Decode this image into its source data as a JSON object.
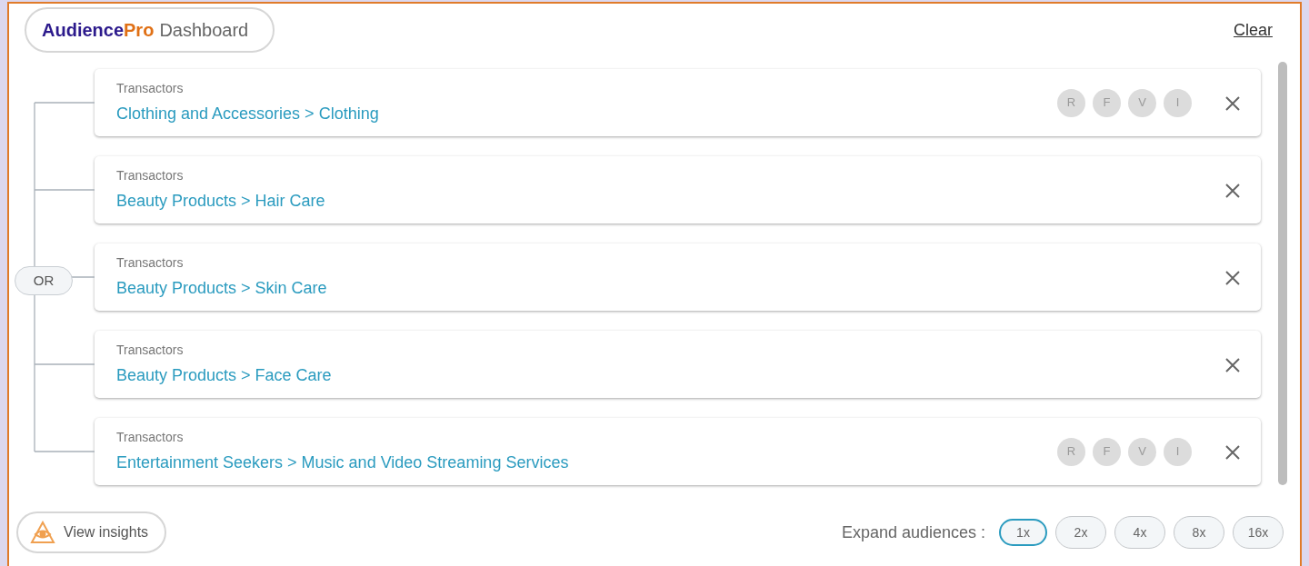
{
  "brand": {
    "name": "Audience",
    "name_accent": "Pro",
    "subtitle": "Dashboard"
  },
  "clear_link": "Clear",
  "operator": "OR",
  "segments": [
    {
      "category": "Transactors",
      "path": "Clothing and Accessories > Clothing",
      "badges": [
        "R",
        "F",
        "V",
        "I"
      ]
    },
    {
      "category": "Transactors",
      "path": "Beauty Products > Hair Care"
    },
    {
      "category": "Transactors",
      "path": "Beauty Products > Skin Care"
    },
    {
      "category": "Transactors",
      "path": "Beauty Products > Face Care"
    },
    {
      "category": "Transactors",
      "path": "Entertainment Seekers > Music and Video Streaming Services",
      "badges": [
        "R",
        "F",
        "V",
        "I"
      ]
    }
  ],
  "insights_button": "View insights",
  "expand": {
    "label": "Expand audiences :",
    "options": [
      {
        "label": "1x",
        "selected": true
      },
      {
        "label": "2x",
        "selected": false
      },
      {
        "label": "4x",
        "selected": false
      },
      {
        "label": "8x",
        "selected": false
      },
      {
        "label": "16x",
        "selected": false
      }
    ]
  }
}
